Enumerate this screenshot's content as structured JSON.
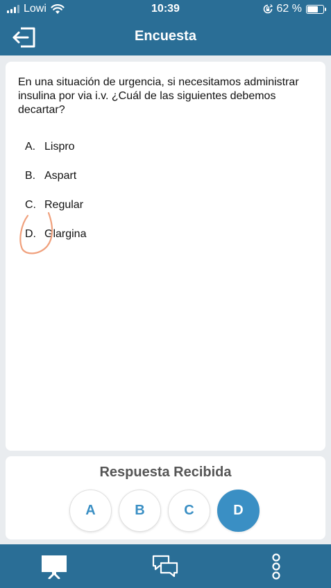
{
  "status_bar": {
    "carrier": "Lowi",
    "time": "10:39",
    "battery": "62 %",
    "icons": [
      "signal-icon",
      "wifi-icon",
      "rotation-lock-icon",
      "battery-icon"
    ]
  },
  "header": {
    "title": "Encuesta",
    "back_icon": "exit-icon"
  },
  "question": {
    "text": "En una situación de urgencia, si necesitamos administrar insulina por via i.v. ¿Cuál de las siguientes debemos decartar?",
    "options": [
      {
        "letter": "A.",
        "label": "Lispro"
      },
      {
        "letter": "B.",
        "label": "Aspart"
      },
      {
        "letter": "C.",
        "label": "Regular"
      },
      {
        "letter": "D.",
        "label": "Glargina"
      }
    ]
  },
  "answer": {
    "title": "Respuesta Recibida",
    "buttons": [
      "A",
      "B",
      "C",
      "D"
    ],
    "selected": "D"
  },
  "nav": {
    "items": [
      "presentation-icon",
      "chat-icon",
      "more-icon"
    ]
  },
  "colors": {
    "primary": "#2a6e96",
    "accent": "#3a8fc4",
    "annotation": "#f0a07c"
  }
}
